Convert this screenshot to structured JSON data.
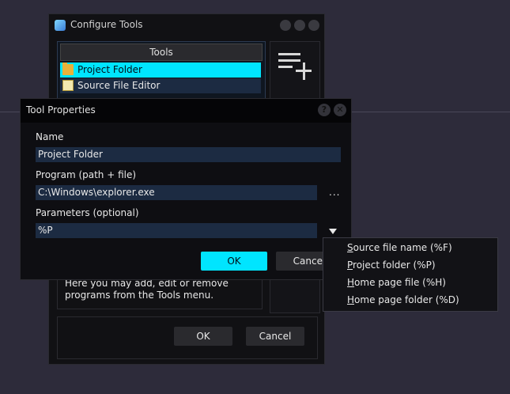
{
  "configure_tools": {
    "title": "Configure Tools",
    "tools_header": "Tools",
    "tools": [
      {
        "label": "Project Folder",
        "icon": "folder-icon",
        "selected": true
      },
      {
        "label": "Source File Editor",
        "icon": "text-editor-icon",
        "selected": false
      }
    ],
    "info_text": "Here you may add, edit or remove programs from the Tools menu.",
    "ok_label": "OK",
    "cancel_label": "Cancel"
  },
  "tool_properties": {
    "title": "Tool Properties",
    "name_label": "Name",
    "name_value": "Project Folder",
    "program_label": "Program (path + file)",
    "program_value": "C:\\Windows\\explorer.exe",
    "browse_label": "...",
    "params_label": "Parameters (optional)",
    "params_value": "%P",
    "ok_label": "OK",
    "cancel_label": "Cancel",
    "help_glyph": "?",
    "close_glyph": "✕"
  },
  "param_menu": {
    "items": [
      {
        "accel": "S",
        "rest": "ource file name (%F)"
      },
      {
        "accel": "P",
        "rest": "roject folder (%P)"
      },
      {
        "accel": "H",
        "rest": "ome page file (%H)"
      },
      {
        "accel": "H",
        "rest": "ome page folder (%D)"
      }
    ]
  },
  "colors": {
    "accent": "#00e5ff",
    "field_bg": "#1c2b42",
    "window_bg": "#111114",
    "desktop_bg": "#2d2b3a"
  }
}
